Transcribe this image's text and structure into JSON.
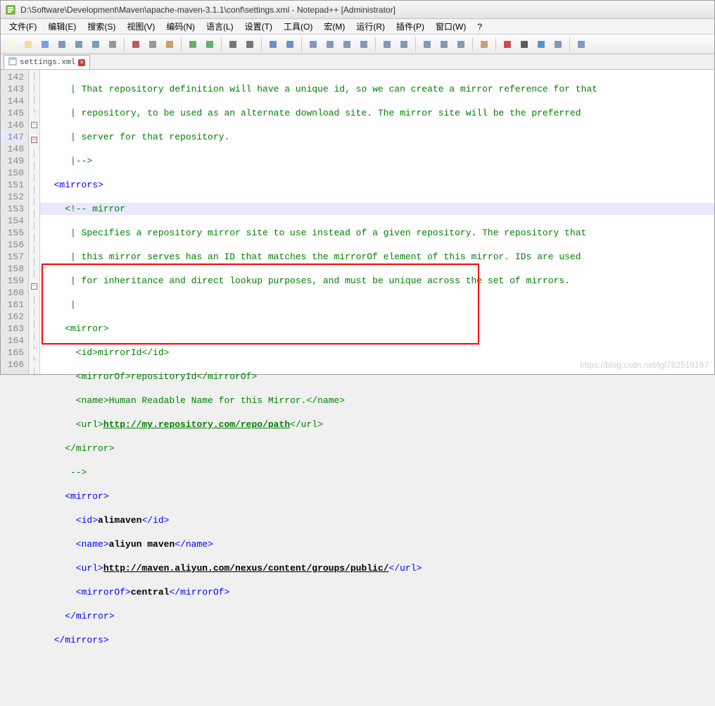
{
  "title": "D:\\Software\\Development\\Maven\\apache-maven-3.1.1\\conf\\settings.xml - Notepad++ [Administrator]",
  "menubar": [
    "文件(F)",
    "编辑(E)",
    "搜索(S)",
    "视图(V)",
    "编码(N)",
    "语言(L)",
    "设置(T)",
    "工具(O)",
    "宏(M)",
    "运行(R)",
    "插件(P)",
    "窗口(W)",
    "?"
  ],
  "toolbar_icons": [
    "new",
    "open",
    "save",
    "save-all",
    "close",
    "close-all",
    "print",
    "",
    "cut",
    "copy",
    "paste",
    "",
    "undo",
    "redo",
    "",
    "find",
    "replace",
    "",
    "zoom-in",
    "zoom-out",
    "",
    "sync",
    "word-wrap",
    "show-all",
    "indent",
    "",
    "fold-all",
    "unfold-all",
    "",
    "hidden",
    "comment",
    "uncomment",
    "",
    "eye",
    "",
    "record",
    "stop",
    "play",
    "play-multi",
    "",
    "list"
  ],
  "tab": {
    "name": "settings.xml"
  },
  "lines_start": 142,
  "lines_end": 166,
  "code": {
    "l142": "     | That repository definition will have a unique id, so we can create a mirror reference for that",
    "l143": "     | repository, to be used as an alternate download site. The mirror site will be the preferred",
    "l144": "     | server for that repository.",
    "l145": "     |-->",
    "l146_open": "  <",
    "l146_tag": "mirrors",
    "l146_close": ">",
    "l147": "    <!-- mirror",
    "l148": "     | Specifies a repository mirror site to use instead of a given repository. The repository that",
    "l149": "     | this mirror serves has an ID that matches the mirrorOf element of this mirror. IDs are used",
    "l150": "     | for inheritance and direct lookup purposes, and must be unique across the set of mirrors.",
    "l151": "     |",
    "l152_open": "    <mirror>",
    "l153_pre": "      <id>",
    "l153_val": "mirrorId",
    "l153_post": "</id>",
    "l154_pre": "      <mirrorOf>",
    "l154_val": "repositoryId",
    "l154_post": "</mirrorOf>",
    "l155_pre": "      <name>",
    "l155_val": "Human Readable Name for this Mirror.",
    "l155_post": "</name>",
    "l156_pre": "      <url>",
    "l156_url": "http://my.repository.com/repo/path",
    "l156_post": "</url>",
    "l157": "    </mirror>",
    "l158": "     -->",
    "l159_open": "    <",
    "l159_tag": "mirror",
    "l159_close": ">",
    "l160_pre": "      <",
    "l160_tag1": "id",
    "l160_mid": ">",
    "l160_val": "alimaven",
    "l160_ct": "</",
    "l160_tag2": "id",
    "l160_end": ">",
    "l161_pre": "      <",
    "l161_tag1": "name",
    "l161_mid": ">",
    "l161_val": "aliyun maven",
    "l161_ct": "</",
    "l161_tag2": "name",
    "l161_end": ">",
    "l162_pre": "      <",
    "l162_tag1": "url",
    "l162_mid": ">",
    "l162_url": "http://maven.aliyun.com/nexus/content/groups/public/",
    "l162_ct": "</",
    "l162_tag2": "url",
    "l162_end": ">",
    "l163_pre": "      <",
    "l163_tag1": "mirrorOf",
    "l163_mid": ">",
    "l163_val": "central",
    "l163_ct": "</",
    "l163_tag2": "mirrorOf",
    "l163_end": ">",
    "l164_pre": "    </",
    "l164_tag": "mirror",
    "l164_end": ">",
    "l165_pre": "  </",
    "l165_tag": "mirrors",
    "l165_end": ">"
  },
  "watermark": "https://blog.csdn.net/lgl782519197"
}
